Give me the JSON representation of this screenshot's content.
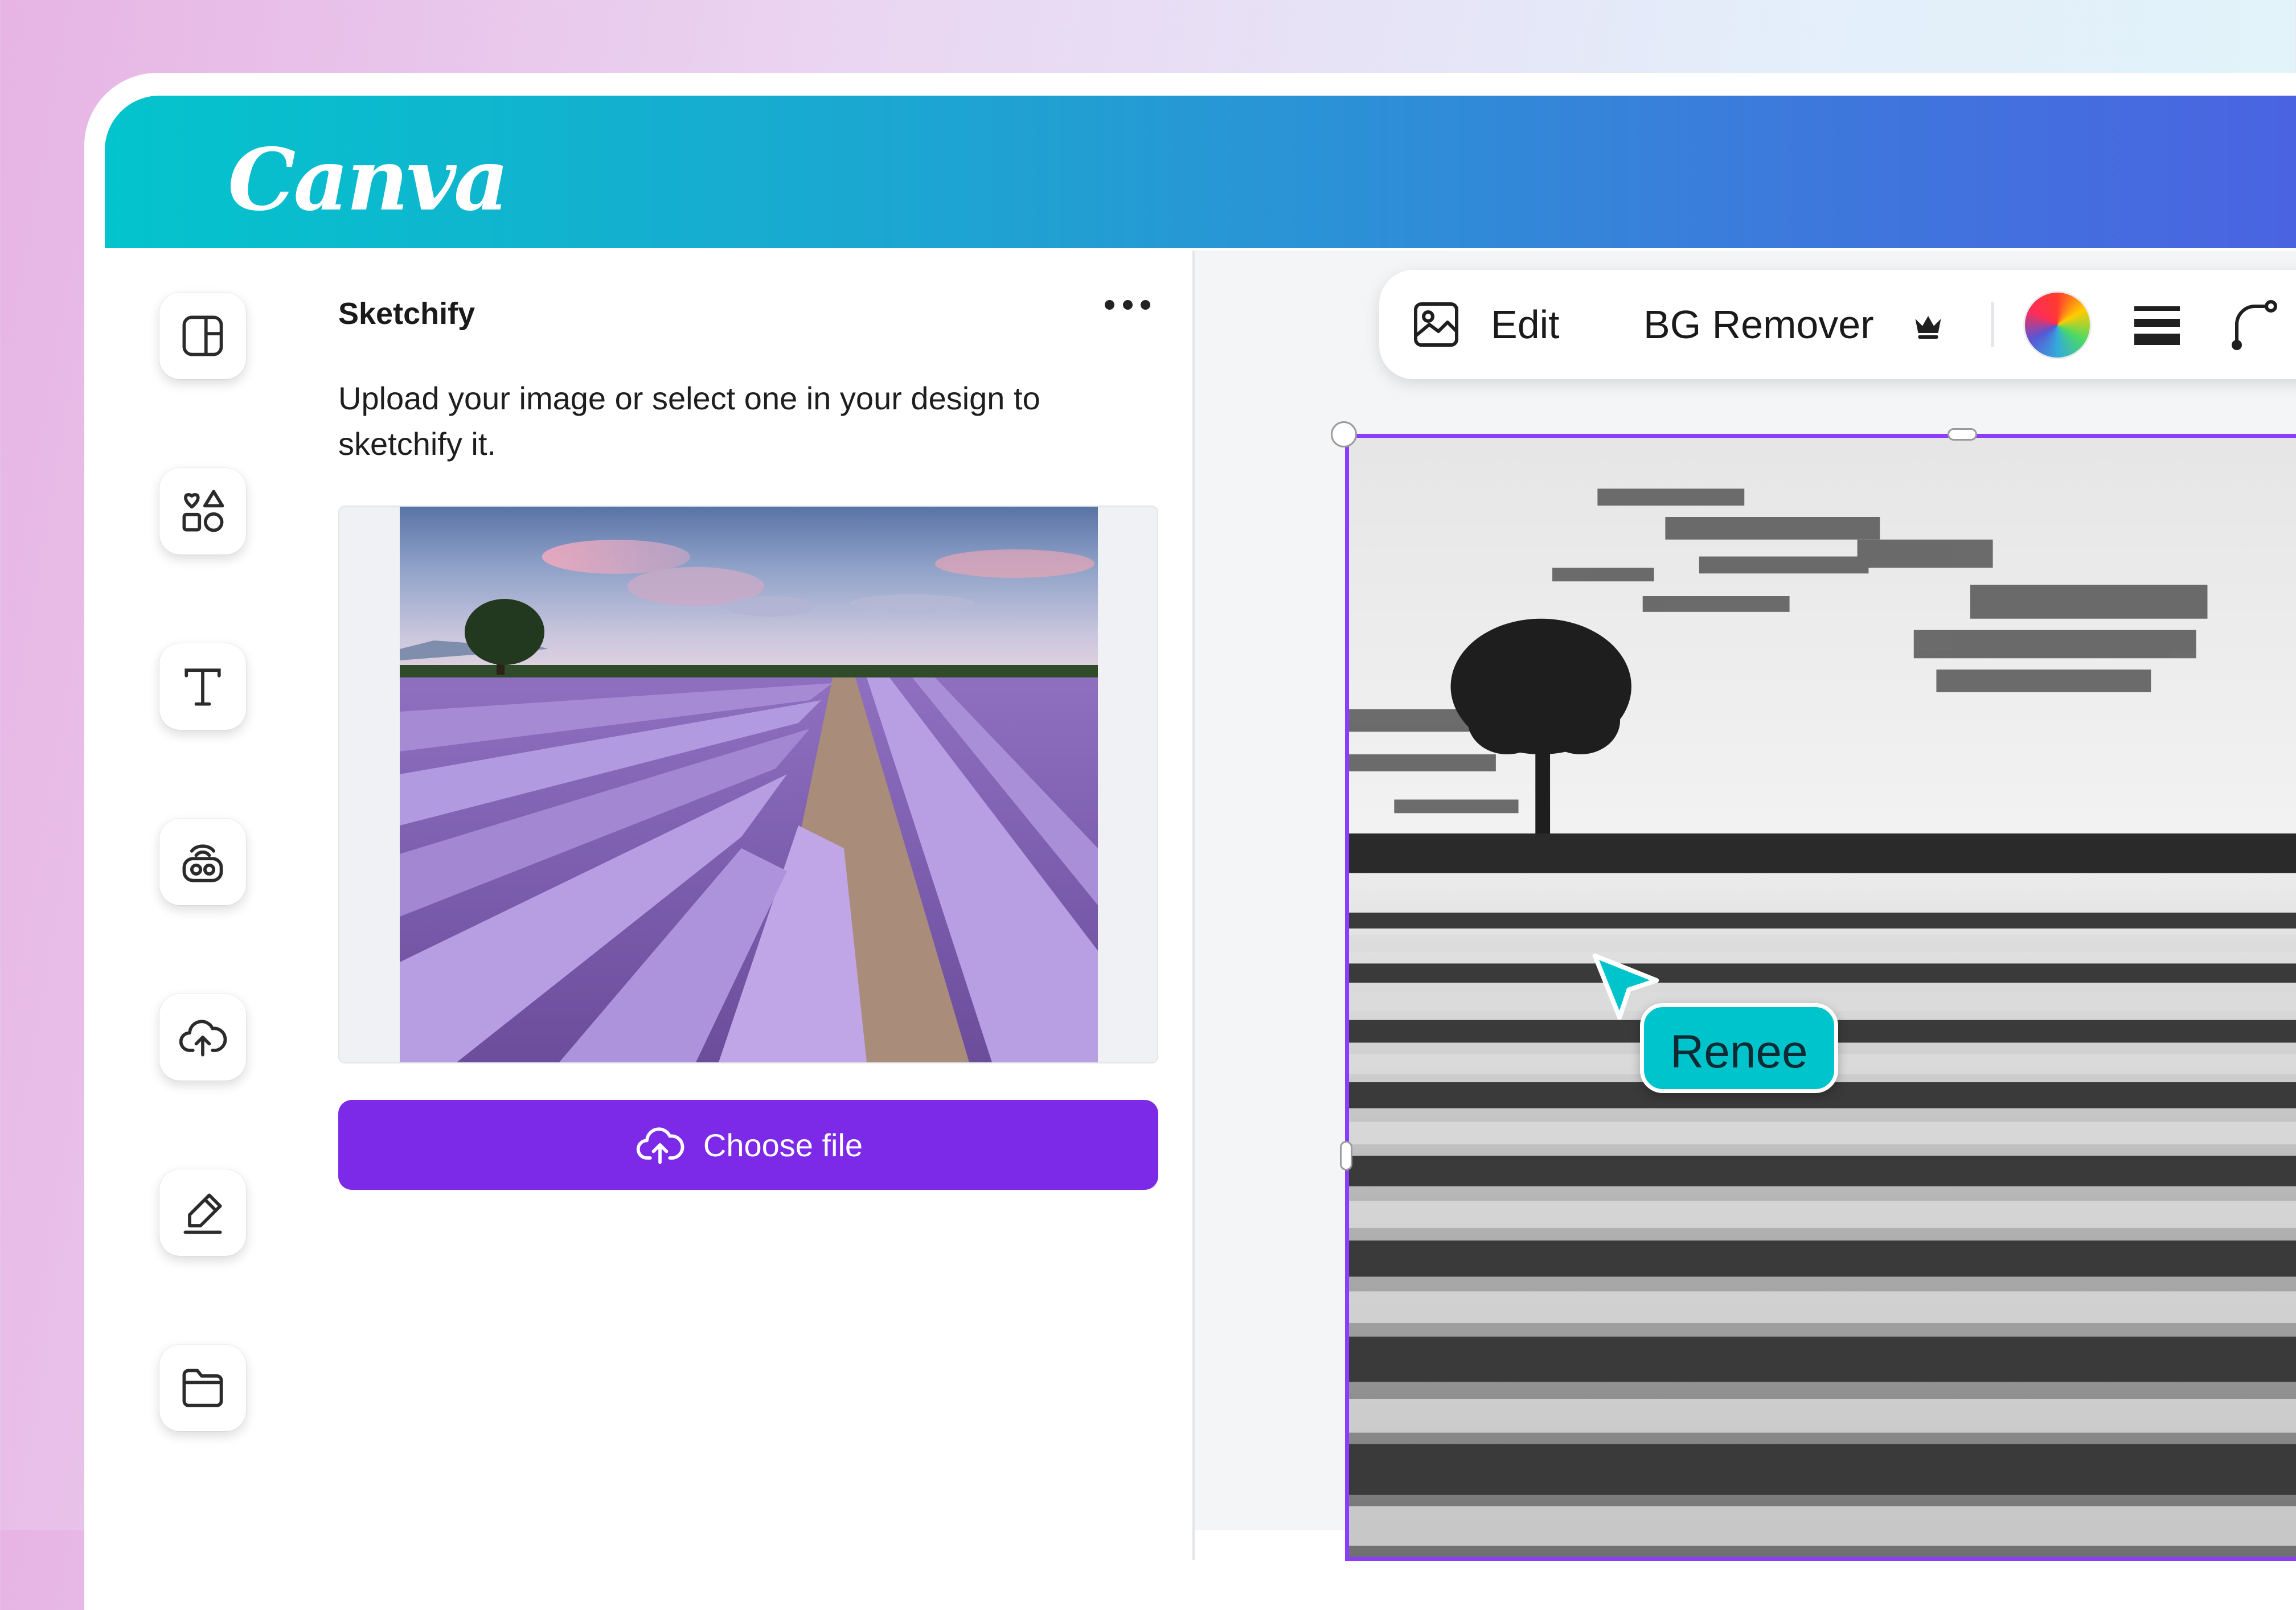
{
  "app": {
    "logo_text": "Canva"
  },
  "sidebar": {
    "items": [
      {
        "name": "design",
        "icon": "layout-icon"
      },
      {
        "name": "elements",
        "icon": "shapes-icon"
      },
      {
        "name": "text",
        "icon": "text-icon"
      },
      {
        "name": "brand",
        "icon": "brand-kit-icon"
      },
      {
        "name": "uploads",
        "icon": "cloud-upload-icon"
      },
      {
        "name": "draw",
        "icon": "pen-icon"
      },
      {
        "name": "projects",
        "icon": "folder-icon"
      }
    ]
  },
  "panel": {
    "title": "Sketchify",
    "description": "Upload your image or select one in your design to sketchify it.",
    "choose_file_label": "Choose file"
  },
  "toolbar": {
    "edit_label": "Edit",
    "bg_remover_label": "BG Remover"
  },
  "collaborator": {
    "name": "Renee"
  },
  "colors": {
    "brand_purple": "#7d2ae8",
    "selection": "#8b3dff",
    "collaborator": "#00c4cc",
    "header_start": "#03c4cc",
    "header_end": "#4c61e2"
  }
}
